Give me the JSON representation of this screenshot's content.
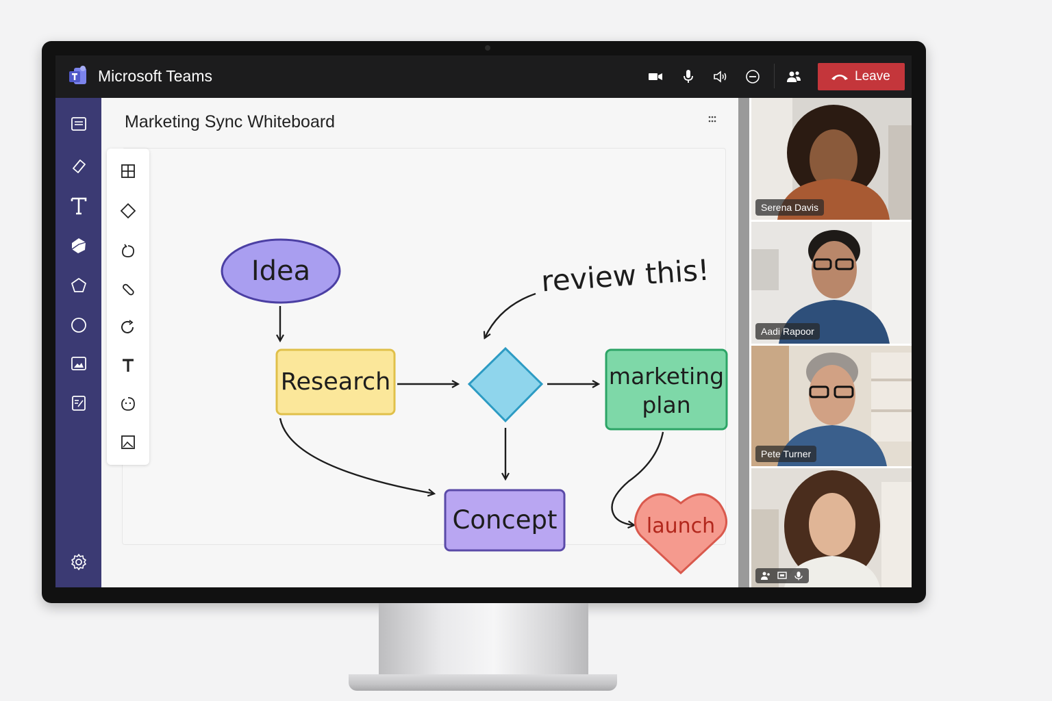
{
  "app": {
    "title": "Microsoft Teams"
  },
  "titlebar": {
    "icons": [
      "video-camera-icon",
      "microphone-icon",
      "speaker-icon",
      "minus-circle-icon",
      "people-icon"
    ],
    "leave_label": "Leave",
    "leave_color": "#c4363b"
  },
  "rail": {
    "icons": [
      "notes-icon",
      "eraser-icon",
      "text-icon",
      "shape-icon",
      "pentagon-icon",
      "circle-icon",
      "image-icon",
      "form-icon",
      "settings-icon"
    ]
  },
  "board": {
    "title": "Marketing Sync Whiteboard",
    "tools": [
      "grid-icon",
      "diamond-icon",
      "lasso-icon",
      "pen-icon",
      "rotate-icon",
      "text-tool-icon",
      "reaction-icon",
      "image-icon"
    ],
    "nodes": {
      "idea": "Idea",
      "research": "Research",
      "marketing": "marketing",
      "plan": "plan",
      "concept": "Concept",
      "launch": "launch",
      "note": "review this!"
    },
    "colors": {
      "idea": "#a99ef0",
      "research": "#fbe79a",
      "decision": "#8fd5ec",
      "marketing": "#7ed8a8",
      "concept": "#b9a6f2",
      "launch": "#f59a8e"
    }
  },
  "participants": [
    {
      "name": "Serena Davis"
    },
    {
      "name": "Aadi Rapoor"
    },
    {
      "name": "Pete Turner"
    },
    {
      "name": "",
      "status_icons": [
        "person-icon",
        "screen-share-icon",
        "mic-icon"
      ]
    }
  ]
}
